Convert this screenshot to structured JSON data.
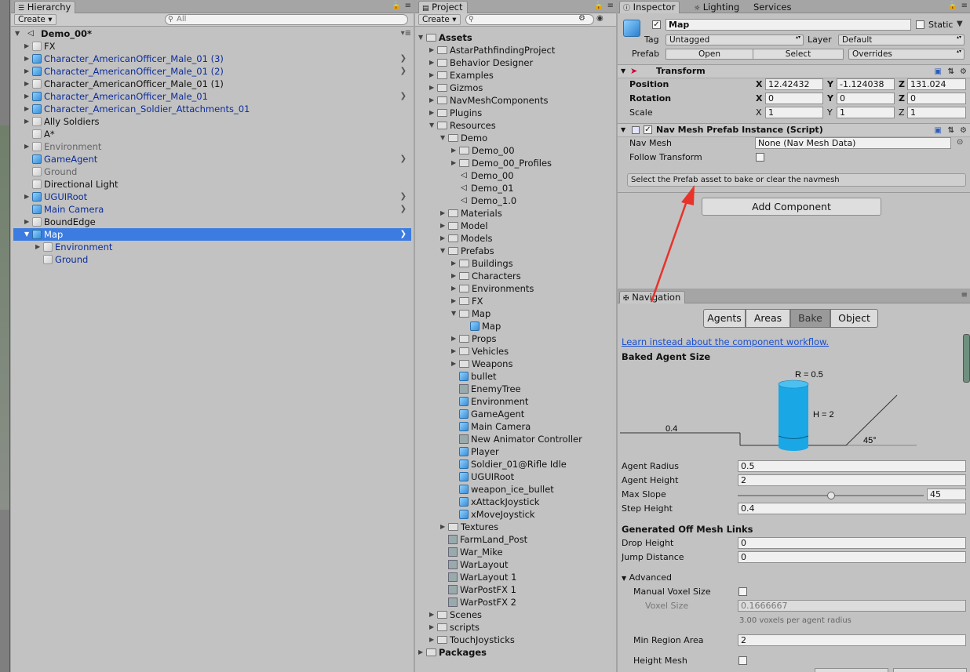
{
  "hierarchy": {
    "tab_label": "Hierarchy",
    "create_label": "Create",
    "search_placeholder": "All",
    "scene_name": "Demo_00*",
    "items": [
      {
        "label": "FX",
        "indent": 1,
        "icon": "cube-grey",
        "expandable": true,
        "style": "normal",
        "chevron": false
      },
      {
        "label": "Character_AmericanOfficer_Male_01 (3)",
        "indent": 1,
        "icon": "cube-blue",
        "expandable": true,
        "style": "blue",
        "chevron": true
      },
      {
        "label": "Character_AmericanOfficer_Male_01 (2)",
        "indent": 1,
        "icon": "cube-blue",
        "expandable": true,
        "style": "blue",
        "chevron": true
      },
      {
        "label": "Character_AmericanOfficer_Male_01 (1)",
        "indent": 1,
        "icon": "cube-grey",
        "expandable": true,
        "style": "normal",
        "chevron": false
      },
      {
        "label": "Character_AmericanOfficer_Male_01",
        "indent": 1,
        "icon": "cube-blue",
        "expandable": true,
        "style": "blue",
        "chevron": true
      },
      {
        "label": "Character_American_Soldier_Attachments_01",
        "indent": 1,
        "icon": "cube-blue",
        "expandable": true,
        "style": "blue",
        "chevron": false
      },
      {
        "label": "Ally Soldiers",
        "indent": 1,
        "icon": "cube-grey",
        "expandable": true,
        "style": "normal",
        "chevron": false
      },
      {
        "label": "A*",
        "indent": 1,
        "icon": "cube-grey",
        "expandable": false,
        "style": "normal",
        "chevron": false
      },
      {
        "label": "Environment",
        "indent": 1,
        "icon": "cube-grey",
        "expandable": true,
        "style": "grey",
        "chevron": false
      },
      {
        "label": "GameAgent",
        "indent": 1,
        "icon": "cube-blue",
        "expandable": false,
        "style": "blue",
        "chevron": true
      },
      {
        "label": "Ground",
        "indent": 1,
        "icon": "cube-grey",
        "expandable": false,
        "style": "grey",
        "chevron": false
      },
      {
        "label": "Directional Light",
        "indent": 1,
        "icon": "cube-grey",
        "expandable": false,
        "style": "normal",
        "chevron": false
      },
      {
        "label": "UGUIRoot",
        "indent": 1,
        "icon": "cube-blue",
        "expandable": true,
        "style": "blue",
        "chevron": true
      },
      {
        "label": "Main Camera",
        "indent": 1,
        "icon": "cube-blue",
        "expandable": false,
        "style": "blue",
        "chevron": true
      },
      {
        "label": "BoundEdge",
        "indent": 1,
        "icon": "cube-grey",
        "expandable": true,
        "style": "normal",
        "chevron": false
      },
      {
        "label": "Map",
        "indent": 1,
        "icon": "cube-blue",
        "expandable": true,
        "expanded": true,
        "style": "selected",
        "chevron": true
      },
      {
        "label": "Environment",
        "indent": 2,
        "icon": "cube-grey",
        "expandable": true,
        "style": "blue",
        "chevron": false
      },
      {
        "label": "Ground",
        "indent": 2,
        "icon": "cube-grey",
        "expandable": false,
        "style": "blue",
        "chevron": false
      }
    ]
  },
  "project": {
    "tab_label": "Project",
    "create_label": "Create",
    "items": [
      {
        "label": "Assets",
        "indent": 0,
        "icon": "folder",
        "expandable": true,
        "expanded": true,
        "bold": true
      },
      {
        "label": "AstarPathfindingProject",
        "indent": 1,
        "icon": "folder",
        "expandable": true
      },
      {
        "label": "Behavior Designer",
        "indent": 1,
        "icon": "folder",
        "expandable": true
      },
      {
        "label": "Examples",
        "indent": 1,
        "icon": "folder",
        "expandable": true
      },
      {
        "label": "Gizmos",
        "indent": 1,
        "icon": "folder",
        "expandable": true
      },
      {
        "label": "NavMeshComponents",
        "indent": 1,
        "icon": "folder",
        "expandable": true
      },
      {
        "label": "Plugins",
        "indent": 1,
        "icon": "folder",
        "expandable": true
      },
      {
        "label": "Resources",
        "indent": 1,
        "icon": "folder",
        "expandable": true,
        "expanded": true
      },
      {
        "label": "Demo",
        "indent": 2,
        "icon": "folder",
        "expandable": true,
        "expanded": true
      },
      {
        "label": "Demo_00",
        "indent": 3,
        "icon": "folder",
        "expandable": true
      },
      {
        "label": "Demo_00_Profiles",
        "indent": 3,
        "icon": "folder",
        "expandable": true
      },
      {
        "label": "Demo_00",
        "indent": 3,
        "icon": "unity",
        "expandable": false
      },
      {
        "label": "Demo_01",
        "indent": 3,
        "icon": "unity",
        "expandable": false
      },
      {
        "label": "Demo_1.0",
        "indent": 3,
        "icon": "unity",
        "expandable": false
      },
      {
        "label": "Materials",
        "indent": 2,
        "icon": "folder",
        "expandable": true
      },
      {
        "label": "Model",
        "indent": 2,
        "icon": "folder",
        "expandable": true
      },
      {
        "label": "Models",
        "indent": 2,
        "icon": "folder",
        "expandable": true
      },
      {
        "label": "Prefabs",
        "indent": 2,
        "icon": "folder",
        "expandable": true,
        "expanded": true
      },
      {
        "label": "Buildings",
        "indent": 3,
        "icon": "folder",
        "expandable": true
      },
      {
        "label": "Characters",
        "indent": 3,
        "icon": "folder",
        "expandable": true
      },
      {
        "label": "Environments",
        "indent": 3,
        "icon": "folder",
        "expandable": true
      },
      {
        "label": "FX",
        "indent": 3,
        "icon": "folder",
        "expandable": true
      },
      {
        "label": "Map",
        "indent": 3,
        "icon": "folder",
        "expandable": true,
        "expanded": true
      },
      {
        "label": "Map",
        "indent": 4,
        "icon": "cube-blue",
        "expandable": false
      },
      {
        "label": "Props",
        "indent": 3,
        "icon": "folder",
        "expandable": true
      },
      {
        "label": "Vehicles",
        "indent": 3,
        "icon": "folder",
        "expandable": true
      },
      {
        "label": "Weapons",
        "indent": 3,
        "icon": "folder",
        "expandable": true
      },
      {
        "label": "bullet",
        "indent": 3,
        "icon": "cube-blue",
        "expandable": false
      },
      {
        "label": "EnemyTree",
        "indent": 3,
        "icon": "file",
        "expandable": false
      },
      {
        "label": "Environment",
        "indent": 3,
        "icon": "cube-blue",
        "expandable": false
      },
      {
        "label": "GameAgent",
        "indent": 3,
        "icon": "cube-blue",
        "expandable": false
      },
      {
        "label": "Main Camera",
        "indent": 3,
        "icon": "cube-blue",
        "expandable": false
      },
      {
        "label": "New Animator Controller",
        "indent": 3,
        "icon": "file",
        "expandable": false
      },
      {
        "label": "Player",
        "indent": 3,
        "icon": "cube-blue",
        "expandable": false
      },
      {
        "label": "Soldier_01@Rifle Idle",
        "indent": 3,
        "icon": "cube-blue",
        "expandable": false
      },
      {
        "label": "UGUIRoot",
        "indent": 3,
        "icon": "cube-blue",
        "expandable": false
      },
      {
        "label": "weapon_ice_bullet",
        "indent": 3,
        "icon": "cube-blue",
        "expandable": false
      },
      {
        "label": "xAttackJoystick",
        "indent": 3,
        "icon": "cube-blue",
        "expandable": false
      },
      {
        "label": "xMoveJoystick",
        "indent": 3,
        "icon": "cube-blue",
        "expandable": false
      },
      {
        "label": "Textures",
        "indent": 2,
        "icon": "folder",
        "expandable": true
      },
      {
        "label": "FarmLand_Post",
        "indent": 2,
        "icon": "file",
        "expandable": false
      },
      {
        "label": "War_Mike",
        "indent": 2,
        "icon": "file",
        "expandable": false
      },
      {
        "label": "WarLayout",
        "indent": 2,
        "icon": "file",
        "expandable": false
      },
      {
        "label": "WarLayout 1",
        "indent": 2,
        "icon": "file",
        "expandable": false
      },
      {
        "label": "WarPostFX 1",
        "indent": 2,
        "icon": "file",
        "expandable": false
      },
      {
        "label": "WarPostFX 2",
        "indent": 2,
        "icon": "file",
        "expandable": false
      },
      {
        "label": "Scenes",
        "indent": 1,
        "icon": "folder",
        "expandable": true
      },
      {
        "label": "scripts",
        "indent": 1,
        "icon": "folder",
        "expandable": true
      },
      {
        "label": "TouchJoysticks",
        "indent": 1,
        "icon": "folder",
        "expandable": true
      },
      {
        "label": "Packages",
        "indent": 0,
        "icon": "folder",
        "expandable": true,
        "bold": true
      }
    ]
  },
  "inspector": {
    "tabs": [
      "Inspector",
      "Lighting",
      "Services"
    ],
    "object_name": "Map",
    "static_label": "Static",
    "tag_label": "Tag",
    "tag_value": "Untagged",
    "layer_label": "Layer",
    "layer_value": "Default",
    "prefab_label": "Prefab",
    "open_label": "Open",
    "select_label": "Select",
    "overrides_label": "Overrides",
    "transform": {
      "title": "Transform",
      "position_label": "Position",
      "rotation_label": "Rotation",
      "scale_label": "Scale",
      "position": {
        "x": "12.42432",
        "y": "-1.124038",
        "z": "131.024"
      },
      "rotation": {
        "x": "0",
        "y": "0",
        "z": "0"
      },
      "scale": {
        "x": "1",
        "y": "1",
        "z": "1"
      },
      "axis_x": "X",
      "axis_y": "Y",
      "axis_z": "Z"
    },
    "navmesh_component": {
      "title": "Nav Mesh Prefab Instance (Script)",
      "nav_mesh_label": "Nav Mesh",
      "nav_mesh_value": "None (Nav Mesh Data)",
      "follow_transform_label": "Follow Transform",
      "help_text": "Select the Prefab asset to bake or clear the navmesh"
    },
    "add_component_label": "Add Component",
    "annotation_color": "#e8322a"
  },
  "navigation": {
    "tab_label": "Navigation",
    "segments": [
      "Agents",
      "Areas",
      "Bake",
      "Object"
    ],
    "active_segment": "Bake",
    "link_text": "Learn instead about the component workflow.",
    "baked_agent_size": "Baked Agent Size",
    "diagram": {
      "radius_label": "R = 0.5",
      "height_label": "H = 2",
      "step_label": "0.4",
      "slope_label": "45°",
      "agent_color": "#1aa7e6"
    },
    "fields": {
      "agent_radius_label": "Agent Radius",
      "agent_radius": "0.5",
      "agent_height_label": "Agent Height",
      "agent_height": "2",
      "max_slope_label": "Max Slope",
      "max_slope": "45",
      "max_slope_fraction": 0.5,
      "step_height_label": "Step Height",
      "step_height": "0.4"
    },
    "offmesh": {
      "title": "Generated Off Mesh Links",
      "drop_height_label": "Drop Height",
      "drop_height": "0",
      "jump_distance_label": "Jump Distance",
      "jump_distance": "0"
    },
    "advanced": {
      "title": "Advanced",
      "manual_voxel_label": "Manual Voxel Size",
      "voxel_size_label": "Voxel Size",
      "voxel_size": "0.1666667",
      "voxel_hint": "3.00 voxels per agent radius",
      "min_region_label": "Min Region Area",
      "min_region": "2",
      "height_mesh_label": "Height Mesh"
    }
  }
}
